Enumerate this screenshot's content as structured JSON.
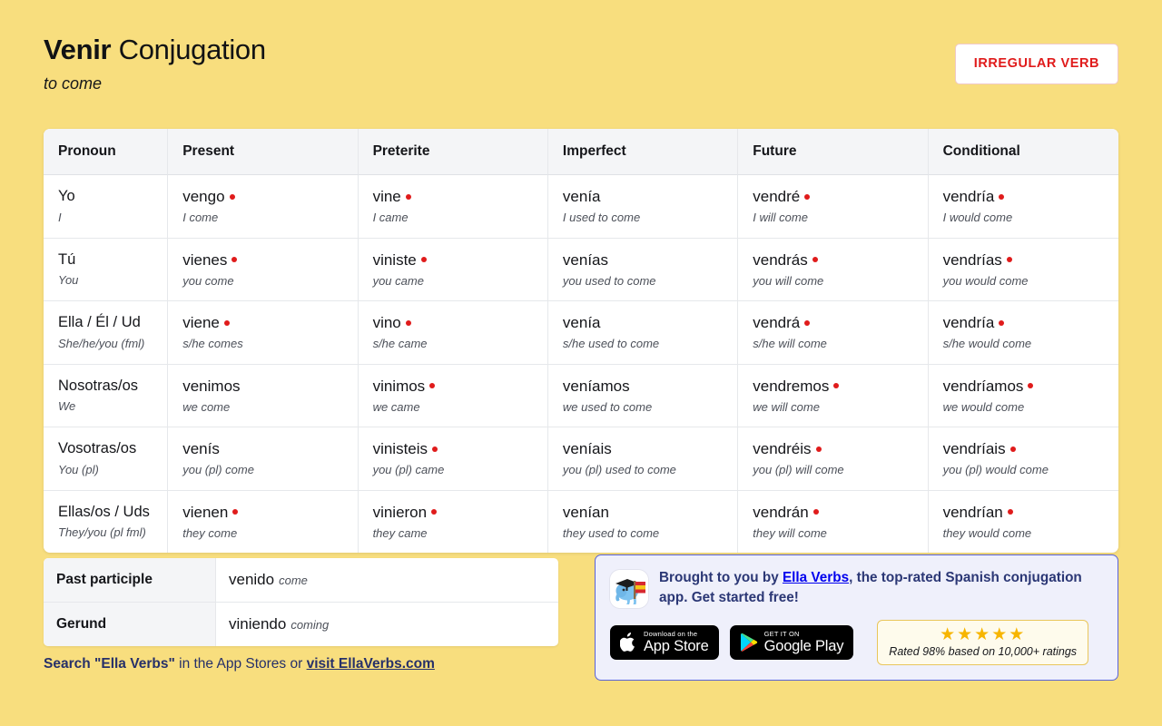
{
  "header": {
    "verb": "Venir",
    "title_rest": " Conjugation",
    "translation": "to come",
    "badge": "IRREGULAR VERB"
  },
  "table": {
    "columns": [
      "Pronoun",
      "Present",
      "Preterite",
      "Imperfect",
      "Future",
      "Conditional"
    ],
    "rows": [
      {
        "pronoun": "Yo",
        "pronoun_en": "I",
        "cells": [
          {
            "form": "vengo",
            "dot": true,
            "en": "I come"
          },
          {
            "form": "vine",
            "dot": true,
            "en": "I came"
          },
          {
            "form": "venía",
            "dot": false,
            "en": "I used to come"
          },
          {
            "form": "vendré",
            "dot": true,
            "en": "I will come"
          },
          {
            "form": "vendría",
            "dot": true,
            "en": "I would come"
          }
        ]
      },
      {
        "pronoun": "Tú",
        "pronoun_en": "You",
        "cells": [
          {
            "form": "vienes",
            "dot": true,
            "en": "you come"
          },
          {
            "form": "viniste",
            "dot": true,
            "en": "you came"
          },
          {
            "form": "venías",
            "dot": false,
            "en": "you used to come"
          },
          {
            "form": "vendrás",
            "dot": true,
            "en": "you will come"
          },
          {
            "form": "vendrías",
            "dot": true,
            "en": "you would come"
          }
        ]
      },
      {
        "pronoun": "Ella / Él / Ud",
        "pronoun_en": "She/he/you (fml)",
        "cells": [
          {
            "form": "viene",
            "dot": true,
            "en": "s/he comes"
          },
          {
            "form": "vino",
            "dot": true,
            "en": "s/he came"
          },
          {
            "form": "venía",
            "dot": false,
            "en": "s/he used to come"
          },
          {
            "form": "vendrá",
            "dot": true,
            "en": "s/he will come"
          },
          {
            "form": "vendría",
            "dot": true,
            "en": "s/he would come"
          }
        ]
      },
      {
        "pronoun": "Nosotras/os",
        "pronoun_en": "We",
        "cells": [
          {
            "form": "venimos",
            "dot": false,
            "en": "we come"
          },
          {
            "form": "vinimos",
            "dot": true,
            "en": "we came"
          },
          {
            "form": "veníamos",
            "dot": false,
            "en": "we used to come"
          },
          {
            "form": "vendremos",
            "dot": true,
            "en": "we will come"
          },
          {
            "form": "vendríamos",
            "dot": true,
            "en": "we would come"
          }
        ]
      },
      {
        "pronoun": "Vosotras/os",
        "pronoun_en": "You (pl)",
        "cells": [
          {
            "form": "venís",
            "dot": false,
            "en": "you (pl) come"
          },
          {
            "form": "vinisteis",
            "dot": true,
            "en": "you (pl) came"
          },
          {
            "form": "veníais",
            "dot": false,
            "en": "you (pl) used to come"
          },
          {
            "form": "vendréis",
            "dot": true,
            "en": "you (pl) will come"
          },
          {
            "form": "vendríais",
            "dot": true,
            "en": "you (pl) would come"
          }
        ]
      },
      {
        "pronoun": "Ellas/os / Uds",
        "pronoun_en": "They/you (pl fml)",
        "cells": [
          {
            "form": "vienen",
            "dot": true,
            "en": "they come"
          },
          {
            "form": "vinieron",
            "dot": true,
            "en": "they came"
          },
          {
            "form": "venían",
            "dot": false,
            "en": "they used to come"
          },
          {
            "form": "vendrán",
            "dot": true,
            "en": "they will come"
          },
          {
            "form": "vendrían",
            "dot": true,
            "en": "they would come"
          }
        ]
      }
    ]
  },
  "forms": [
    {
      "label": "Past participle",
      "value": "venido",
      "en": "come"
    },
    {
      "label": "Gerund",
      "value": "viniendo",
      "en": "coming"
    }
  ],
  "search_line": {
    "bold_start": "Search \"Ella Verbs\"",
    "middle": " in the App Stores or ",
    "link": "visit EllaVerbs.com"
  },
  "promo": {
    "text_before": "Brought to you by ",
    "link": "Ella Verbs",
    "text_after": ", the top-rated Spanish conjugation app. Get started free!",
    "app_store": {
      "small": "Download on the",
      "big": "App Store"
    },
    "google_play": {
      "small": "GET IT ON",
      "big": "Google Play"
    },
    "stars": "★★★★★",
    "rating_text": "Rated 98% based on 10,000+ ratings"
  },
  "colors": {
    "background": "#F8DE7E",
    "accent_red": "#E01B1B",
    "promo_border": "#5a63d8",
    "promo_bg": "#EFF0FB",
    "star_gold": "#F7B500",
    "navy_text": "#263069"
  }
}
